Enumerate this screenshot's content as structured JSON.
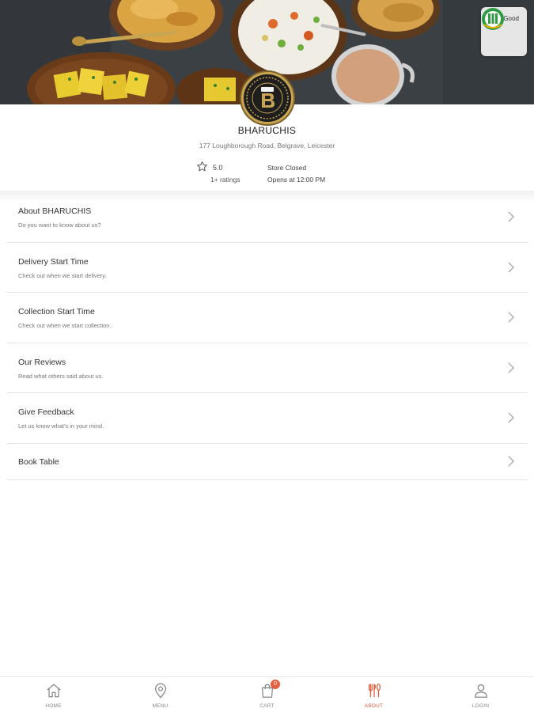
{
  "hero": {
    "hygiene_badge_label": "Very Good",
    "hygiene_icon": "food-hygiene-rating-icon",
    "logo_icon": "bharuchis-logo"
  },
  "restaurant": {
    "name": "BHARUCHIS",
    "address": "177 Loughborough Road, Belgrave, Leicester",
    "rating": "5.0",
    "rating_count": "1+ ratings",
    "status": "Store Closed",
    "opens_at": "Opens at 12:00 PM"
  },
  "menu": [
    {
      "title": "About BHARUCHIS",
      "subtitle": "Do you want to know about us?"
    },
    {
      "title": "Delivery Start Time",
      "subtitle": "Check out when we start delivery."
    },
    {
      "title": "Collection Start Time",
      "subtitle": "Check out when we start collection."
    },
    {
      "title": "Our Reviews",
      "subtitle": "Read what others said about us."
    },
    {
      "title": "Give Feedback",
      "subtitle": "Let us know what's in your mind."
    },
    {
      "title": "Book Table"
    }
  ],
  "bottom_nav": {
    "home": "HOME",
    "menu": "MENU",
    "cart": "CART",
    "cart_count": "0",
    "about": "ABOUT",
    "login": "LOGIN"
  },
  "colors": {
    "accent": "#e2603f",
    "logo_gold": "#c9a552"
  }
}
